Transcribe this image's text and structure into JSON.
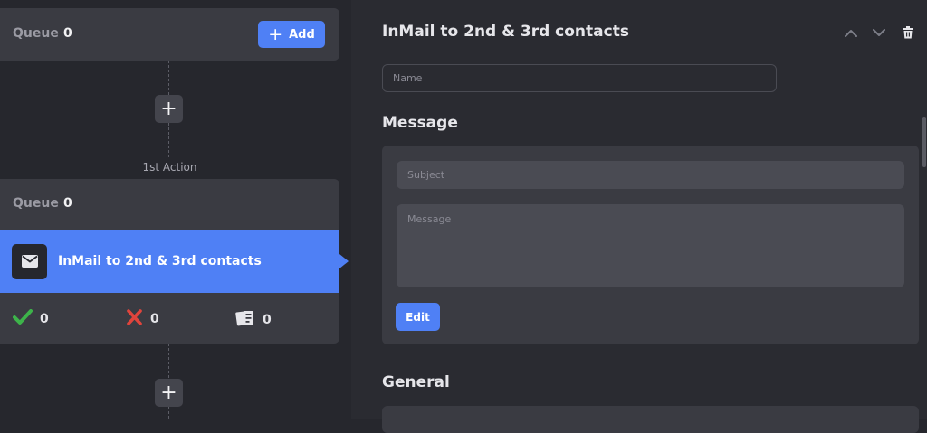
{
  "colors": {
    "accent": "#4f80f5",
    "success": "#3db34a",
    "danger": "#e0443c",
    "card": "#3a3b42",
    "background": "#26272d"
  },
  "left": {
    "queue_top": {
      "label": "Queue",
      "count": "0",
      "add_label": "Add",
      "add_icon": "plus-icon"
    },
    "plus_node_symbol": "+",
    "action_label": "1st Action",
    "action_card": {
      "queue_label": "Queue",
      "queue_count": "0",
      "step_icon": "mail-icon",
      "step_title": "InMail to 2nd & 3rd contacts",
      "stats": [
        {
          "icon": "check-icon",
          "value": "0"
        },
        {
          "icon": "cross-icon",
          "value": "0"
        },
        {
          "icon": "cards-icon",
          "value": "0"
        }
      ]
    }
  },
  "panel": {
    "title": "InMail to 2nd & 3rd contacts",
    "toolbar_icons": [
      "chevron-up-icon",
      "chevron-down-icon",
      "trash-icon"
    ],
    "name_placeholder": "Name",
    "name_value": "",
    "message_section": {
      "title": "Message",
      "subject_placeholder": "Subject",
      "message_placeholder": "Message",
      "edit_label": "Edit"
    },
    "general_section": {
      "title": "General"
    }
  }
}
